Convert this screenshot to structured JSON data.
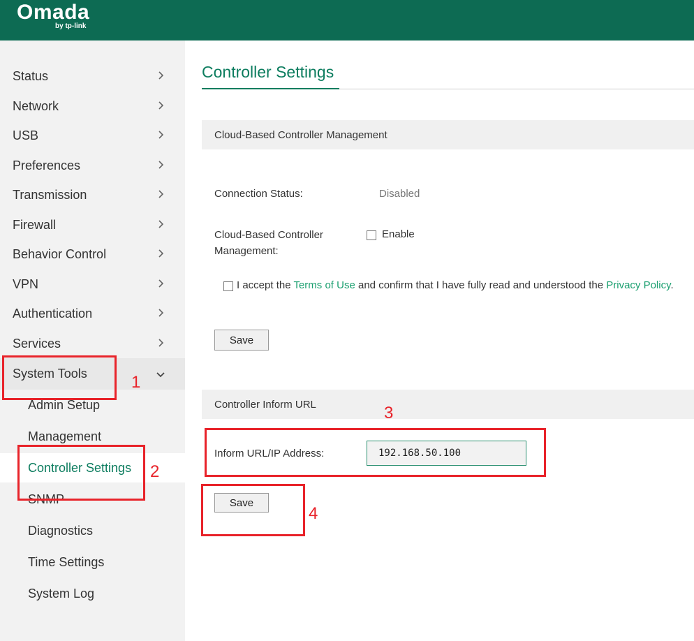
{
  "brand": {
    "name": "Omada",
    "sub": "by tp-link"
  },
  "sidebar": {
    "items": [
      {
        "label": "Status"
      },
      {
        "label": "Network"
      },
      {
        "label": "USB"
      },
      {
        "label": "Preferences"
      },
      {
        "label": "Transmission"
      },
      {
        "label": "Firewall"
      },
      {
        "label": "Behavior Control"
      },
      {
        "label": "VPN"
      },
      {
        "label": "Authentication"
      },
      {
        "label": "Services"
      },
      {
        "label": "System Tools"
      }
    ],
    "subitems": [
      {
        "label": "Admin Setup"
      },
      {
        "label": "Management"
      },
      {
        "label": "Controller Settings"
      },
      {
        "label": "SNMP"
      },
      {
        "label": "Diagnostics"
      },
      {
        "label": "Time Settings"
      },
      {
        "label": "System Log"
      }
    ]
  },
  "page": {
    "title": "Controller Settings"
  },
  "cloud": {
    "section_title": "Cloud-Based Controller Management",
    "status_label": "Connection Status:",
    "status_value": "Disabled",
    "mgmt_label_1": "Cloud-Based Controller",
    "mgmt_label_2": "Management:",
    "enable_label": "Enable",
    "accept_prefix": "I accept the",
    "terms_link": "Terms of Use",
    "accept_middle": "and confirm that I have fully read and understood the",
    "privacy_link": "Privacy Policy",
    "accept_suffix": ".",
    "save_label": "Save"
  },
  "inform": {
    "section_title": "Controller Inform URL",
    "url_label": "Inform URL/IP Address:",
    "url_value": "192.168.50.100",
    "save_label": "Save"
  },
  "annotations": {
    "m1": "1",
    "m2": "2",
    "m3": "3",
    "m4": "4",
    "color": "#e8232a"
  },
  "colors": {
    "header": "#0d6b53",
    "accent": "#0d7d5f",
    "link": "#1a9f6f"
  }
}
